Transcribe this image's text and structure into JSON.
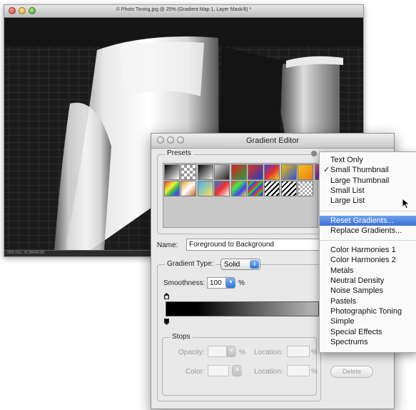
{
  "photo_window": {
    "title": "© Photo Toning.jpg @ 25% (Gradient Map 1, Layer Mask/8) *",
    "status": "25%    Doc: 32.3M/48.0M"
  },
  "dialog": {
    "title": "Gradient Editor",
    "presets_label": "Presets",
    "name_label": "Name:",
    "name_value": "Foreground to Background",
    "gradient_type_label": "Gradient Type:",
    "gradient_type_value": "Solid",
    "smoothness_label": "Smoothness:",
    "smoothness_value": "100",
    "smoothness_unit": "%",
    "stops_label": "Stops",
    "opacity_label": "Opacity:",
    "opacity_unit": "%",
    "location_label": "Location:",
    "location_unit": "%",
    "delete_label": "Delete",
    "color_label": "Color:"
  },
  "swatches": [
    {
      "bg": "linear-gradient(135deg,#000,#fff)"
    },
    {
      "bg": "repeating-conic-gradient(#999 0% 25%,#fff 0% 50%) 0 0/8px 8px"
    },
    {
      "bg": "linear-gradient(135deg,#000,#eee)"
    },
    {
      "bg": "linear-gradient(135deg,#ddd,#222)"
    },
    {
      "bg": "linear-gradient(135deg,#e02020,#20a040)"
    },
    {
      "bg": "linear-gradient(135deg,#e03020,#2040c0)"
    },
    {
      "bg": "linear-gradient(135deg,#4040e0,#e03030,#f0d020)"
    },
    {
      "bg": "linear-gradient(135deg,#f0c000,#3050e0)"
    },
    {
      "bg": "linear-gradient(135deg,#f0c020,#f08010)"
    },
    {
      "bg": "linear-gradient(135deg,#e05080,#7030a0,#f0c020)"
    },
    {
      "bg": "linear-gradient(135deg,#f03030,#f0a020,#f0f040,#40c040,#3060e0,#a030c0)"
    },
    {
      "bg": "linear-gradient(135deg,#e0a030,#fff,#c06020)"
    },
    {
      "bg": "linear-gradient(135deg,#40b0f0,#ffe060)"
    },
    {
      "bg": "linear-gradient(135deg,#3070e0,#f03030,#fff)"
    },
    {
      "bg": "linear-gradient(135deg,#f04040,#40f040,#4040f0,#f0f040)"
    },
    {
      "bg": "repeating-linear-gradient(135deg,#f03030 0 3px,#30c030 3px 6px,#3050f0 6px 9px)"
    },
    {
      "bg": "repeating-linear-gradient(135deg,#000 0 2px,#fff 2px 5px)"
    },
    {
      "bg": "repeating-linear-gradient(135deg,#000 0 2px,#fff 2px 5px)"
    },
    {
      "bg": "repeating-conic-gradient(#aaa 0% 25%,#fff 0% 50%) 0 0/6px 6px"
    }
  ],
  "menu": {
    "items": [
      {
        "label": "Text Only",
        "checked": false,
        "highlighted": false
      },
      {
        "label": "Small Thumbnail",
        "checked": true,
        "highlighted": false
      },
      {
        "label": "Large Thumbnail",
        "checked": false,
        "highlighted": false
      },
      {
        "label": "Small List",
        "checked": false,
        "highlighted": false
      },
      {
        "label": "Large List",
        "checked": false,
        "highlighted": false
      },
      {
        "label": "Reset Gradients...",
        "checked": false,
        "highlighted": true
      },
      {
        "label": "Replace Gradients...",
        "checked": false,
        "highlighted": false
      },
      {
        "label": "Color Harmonies 1",
        "checked": false,
        "highlighted": false
      },
      {
        "label": "Color Harmonies 2",
        "checked": false,
        "highlighted": false
      },
      {
        "label": "Metals",
        "checked": false,
        "highlighted": false
      },
      {
        "label": "Neutral Density",
        "checked": false,
        "highlighted": false
      },
      {
        "label": "Noise Samples",
        "checked": false,
        "highlighted": false
      },
      {
        "label": "Pastels",
        "checked": false,
        "highlighted": false
      },
      {
        "label": "Photographic Toning",
        "checked": false,
        "highlighted": false
      },
      {
        "label": "Simple",
        "checked": false,
        "highlighted": false
      },
      {
        "label": "Special Effects",
        "checked": false,
        "highlighted": false
      },
      {
        "label": "Spectrums",
        "checked": false,
        "highlighted": false
      }
    ],
    "highlight_color": "#3a6fd6"
  }
}
